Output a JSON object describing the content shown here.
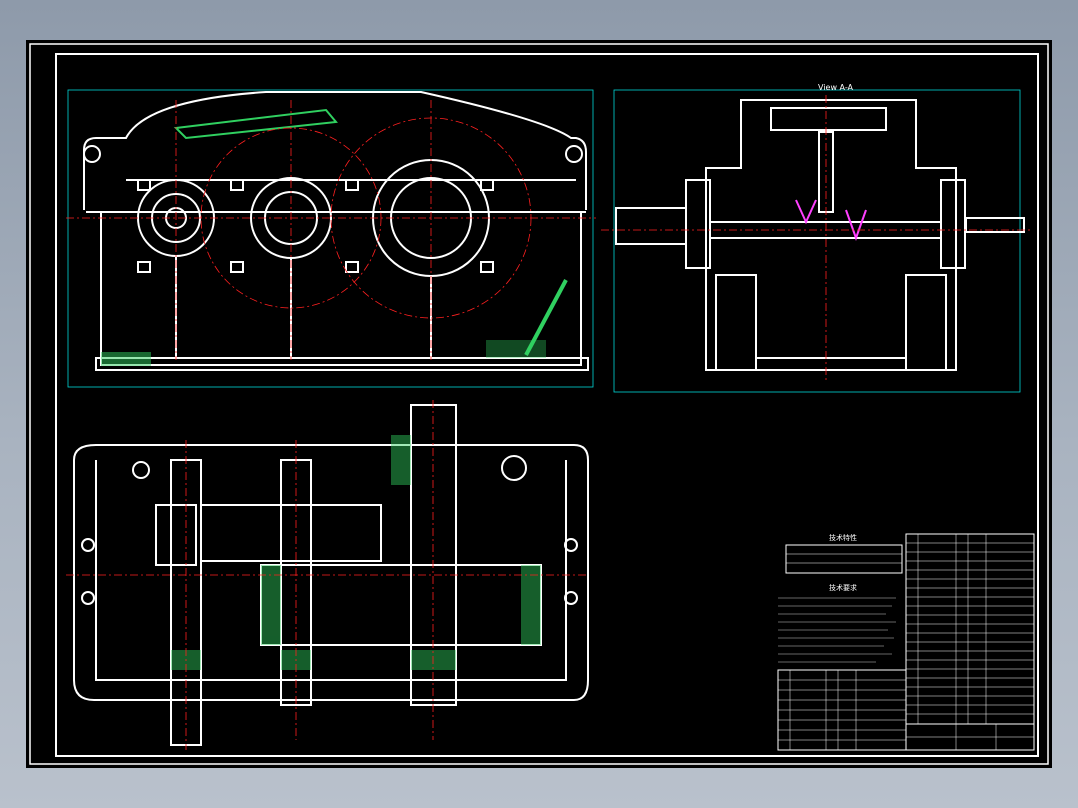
{
  "drawing": {
    "view_label": "View A-A",
    "tech_spec_title": "技术特性",
    "tech_req_title": "技术要求"
  },
  "colors": {
    "background": "#000000",
    "outline": "#ffffff",
    "centerline": "#ff2020",
    "dimension": "#00d8d8",
    "section": "#30d060",
    "highlight": "#ff40ff"
  }
}
